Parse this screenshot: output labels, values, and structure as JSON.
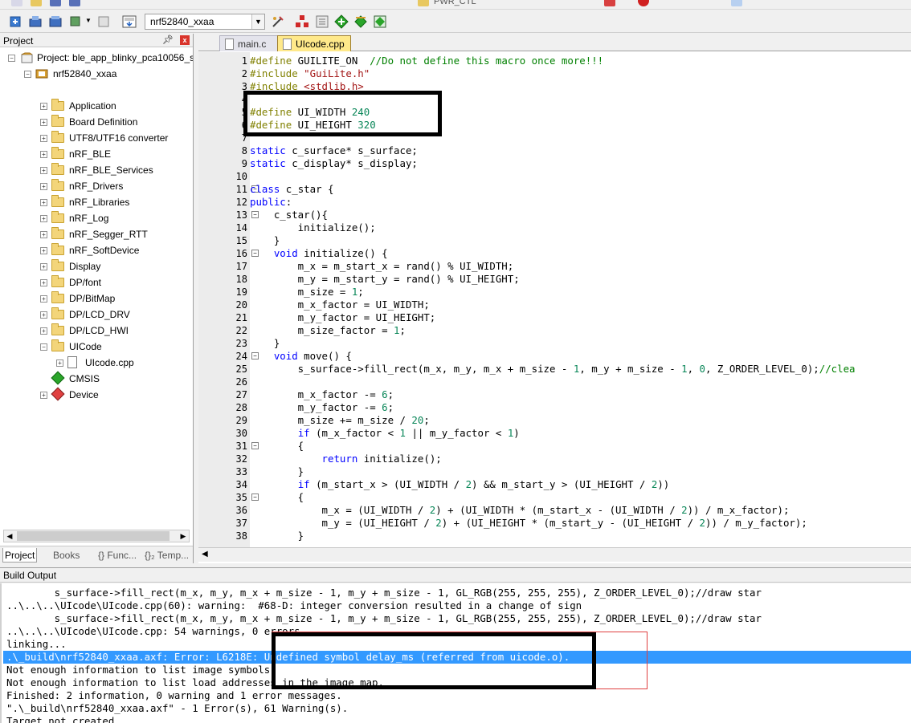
{
  "toolbar": {
    "target_name": "nrf52840_xxaa",
    "top_combo": "PWR_CTL"
  },
  "project_panel": {
    "title": "Project",
    "project_label": "Project: ble_app_blinky_pca10056_s1",
    "target_label": "nrf52840_xxaa",
    "groups": [
      "Application",
      "Board Definition",
      "UTF8/UTF16 converter",
      "nRF_BLE",
      "nRF_BLE_Services",
      "nRF_Drivers",
      "nRF_Libraries",
      "nRF_Log",
      "nRF_Segger_RTT",
      "nRF_SoftDevice",
      "Display",
      "DP/font",
      "DP/BitMap",
      "DP/LCD_DRV",
      "DP/LCD_HWI",
      "UICode"
    ],
    "file_label": "UIcode.cpp",
    "cmsis_label": "CMSIS",
    "device_label": "Device",
    "tabs": [
      "Project",
      "Books",
      "{} Func...",
      "{}₂ Temp..."
    ]
  },
  "editor": {
    "tabs": [
      "main.c",
      "UIcode.cpp"
    ],
    "active_tab": "UIcode.cpp",
    "lines": [
      {
        "n": "1",
        "html": "<span class=\"c-pp\">#define</span> GUILITE_ON  <span class=\"c-cm\">//Do not define this macro once more!!!</span>"
      },
      {
        "n": "2",
        "html": "<span class=\"c-pp\">#include</span> <span class=\"c-str\">\"GuiLite.h\"</span>"
      },
      {
        "n": "3",
        "html": "<span class=\"c-pp\">#include</span> <span class=\"c-str\">&lt;stdlib.h&gt;</span>"
      },
      {
        "n": "4",
        "html": ""
      },
      {
        "n": "5",
        "html": "<span class=\"c-pp\">#define</span> UI_WIDTH <span class=\"c-num\">240</span>"
      },
      {
        "n": "6",
        "html": "<span class=\"c-pp\">#define</span> UI_HEIGHT <span class=\"c-num\">320</span>"
      },
      {
        "n": "7",
        "html": ""
      },
      {
        "n": "8",
        "html": "<span class=\"c-kw\">static</span> c_surface* s_surface;"
      },
      {
        "n": "9",
        "html": "<span class=\"c-kw\">static</span> c_display* s_display;"
      },
      {
        "n": "10",
        "html": ""
      },
      {
        "n": "11",
        "html": "<span class=\"c-kw\">class</span> c_star {"
      },
      {
        "n": "12",
        "html": "<span class=\"c-kw\">public</span>:"
      },
      {
        "n": "13",
        "html": "    c_star(){"
      },
      {
        "n": "14",
        "html": "        initialize();"
      },
      {
        "n": "15",
        "html": "    }"
      },
      {
        "n": "16",
        "html": "    <span class=\"c-kw\">void</span> initialize() {"
      },
      {
        "n": "17",
        "html": "        m_x = m_start_x = rand() % UI_WIDTH;"
      },
      {
        "n": "18",
        "html": "        m_y = m_start_y = rand() % UI_HEIGHT;"
      },
      {
        "n": "19",
        "html": "        m_size = <span class=\"c-num\">1</span>;"
      },
      {
        "n": "20",
        "html": "        m_x_factor = UI_WIDTH;"
      },
      {
        "n": "21",
        "html": "        m_y_factor = UI_HEIGHT;"
      },
      {
        "n": "22",
        "html": "        m_size_factor = <span class=\"c-num\">1</span>;"
      },
      {
        "n": "23",
        "html": "    }"
      },
      {
        "n": "24",
        "html": "    <span class=\"c-kw\">void</span> move() {"
      },
      {
        "n": "25",
        "html": "        s_surface-&gt;fill_rect(m_x, m_y, m_x + m_size - <span class=\"c-num\">1</span>, m_y + m_size - <span class=\"c-num\">1</span>, <span class=\"c-num\">0</span>, Z_ORDER_LEVEL_0);<span class=\"c-cm\">//clea</span>"
      },
      {
        "n": "26",
        "html": ""
      },
      {
        "n": "27",
        "html": "        m_x_factor -= <span class=\"c-num\">6</span>;"
      },
      {
        "n": "28",
        "html": "        m_y_factor -= <span class=\"c-num\">6</span>;"
      },
      {
        "n": "29",
        "html": "        m_size += m_size / <span class=\"c-num\">20</span>;"
      },
      {
        "n": "30",
        "html": "        <span class=\"c-kw\">if</span> (m_x_factor &lt; <span class=\"c-num\">1</span> || m_y_factor &lt; <span class=\"c-num\">1</span>)"
      },
      {
        "n": "31",
        "html": "        {"
      },
      {
        "n": "32",
        "html": "            <span class=\"c-kw\">return</span> initialize();"
      },
      {
        "n": "33",
        "html": "        }"
      },
      {
        "n": "34",
        "html": "        <span class=\"c-kw\">if</span> (m_start_x &gt; (UI_WIDTH / <span class=\"c-num\">2</span>) &amp;&amp; m_start_y &gt; (UI_HEIGHT / <span class=\"c-num\">2</span>))"
      },
      {
        "n": "35",
        "html": "        {"
      },
      {
        "n": "36",
        "html": "            m_x = (UI_WIDTH / <span class=\"c-num\">2</span>) + (UI_WIDTH * (m_start_x - (UI_WIDTH / <span class=\"c-num\">2</span>)) / m_x_factor);"
      },
      {
        "n": "37",
        "html": "            m_y = (UI_HEIGHT / <span class=\"c-num\">2</span>) + (UI_HEIGHT * (m_start_y - (UI_HEIGHT / <span class=\"c-num\">2</span>)) / m_y_factor);"
      },
      {
        "n": "38",
        "html": "        }"
      }
    ]
  },
  "build_output": {
    "title": "Build Output",
    "lines": [
      "        s_surface->fill_rect(m_x, m_y, m_x + m_size - 1, m_y + m_size - 1, GL_RGB(255, 255, 255), Z_ORDER_LEVEL_0);//draw star",
      "..\\..\\..\\UIcode\\UIcode.cpp(60): warning:  #68-D: integer conversion resulted in a change of sign",
      "        s_surface->fill_rect(m_x, m_y, m_x + m_size - 1, m_y + m_size - 1, GL_RGB(255, 255, 255), Z_ORDER_LEVEL_0);//draw star",
      "..\\..\\..\\UIcode\\UIcode.cpp: 54 warnings, 0 errors",
      "linking...",
      ".\\_build\\nrf52840_xxaa.axf: Error: L6218E: Undefined symbol delay_ms (referred from uicode.o).",
      "Not enough information to list image symbols.",
      "Not enough information to list load addresses in the image map.",
      "Finished: 2 information, 0 warning and 1 error messages.",
      "\".\\_build\\nrf52840_xxaa.axf\" - 1 Error(s), 61 Warning(s).",
      "Target not created."
    ],
    "selected_index": 5
  }
}
